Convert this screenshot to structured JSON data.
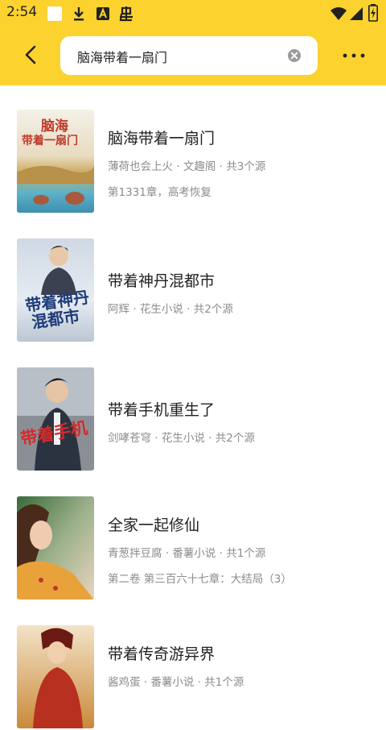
{
  "status_bar": {
    "time": "2:54"
  },
  "search": {
    "query": "脑海带着一扇门"
  },
  "results": [
    {
      "title": "脑海带着一扇门",
      "meta": "薄荷也会上火 · 文趣阁 · 共3个源",
      "latest": "第1331章，高考恢复",
      "cover": {
        "text": [
          "脑海",
          "带着一扇门"
        ]
      }
    },
    {
      "title": "带着神丹混都市",
      "meta": "阿辉 · 花生小说 · 共2个源",
      "latest": "",
      "cover": {
        "text": [
          "带着神丹",
          "混都市"
        ]
      }
    },
    {
      "title": "带着手机重生了",
      "meta": "剑哮苍穹 · 花生小说 · 共2个源",
      "latest": "",
      "cover": {
        "text": [
          "带着手机"
        ]
      }
    },
    {
      "title": "全家一起修仙",
      "meta": "青葱拌豆腐 · 番薯小说 · 共1个源",
      "latest": "第二卷 第三百六十七章：大结局（3）",
      "cover": {
        "text": []
      }
    },
    {
      "title": "带着传奇游异界",
      "meta": "酱鸡蛋 · 番薯小说 · 共1个源",
      "latest": "",
      "cover": {
        "text": []
      }
    }
  ]
}
